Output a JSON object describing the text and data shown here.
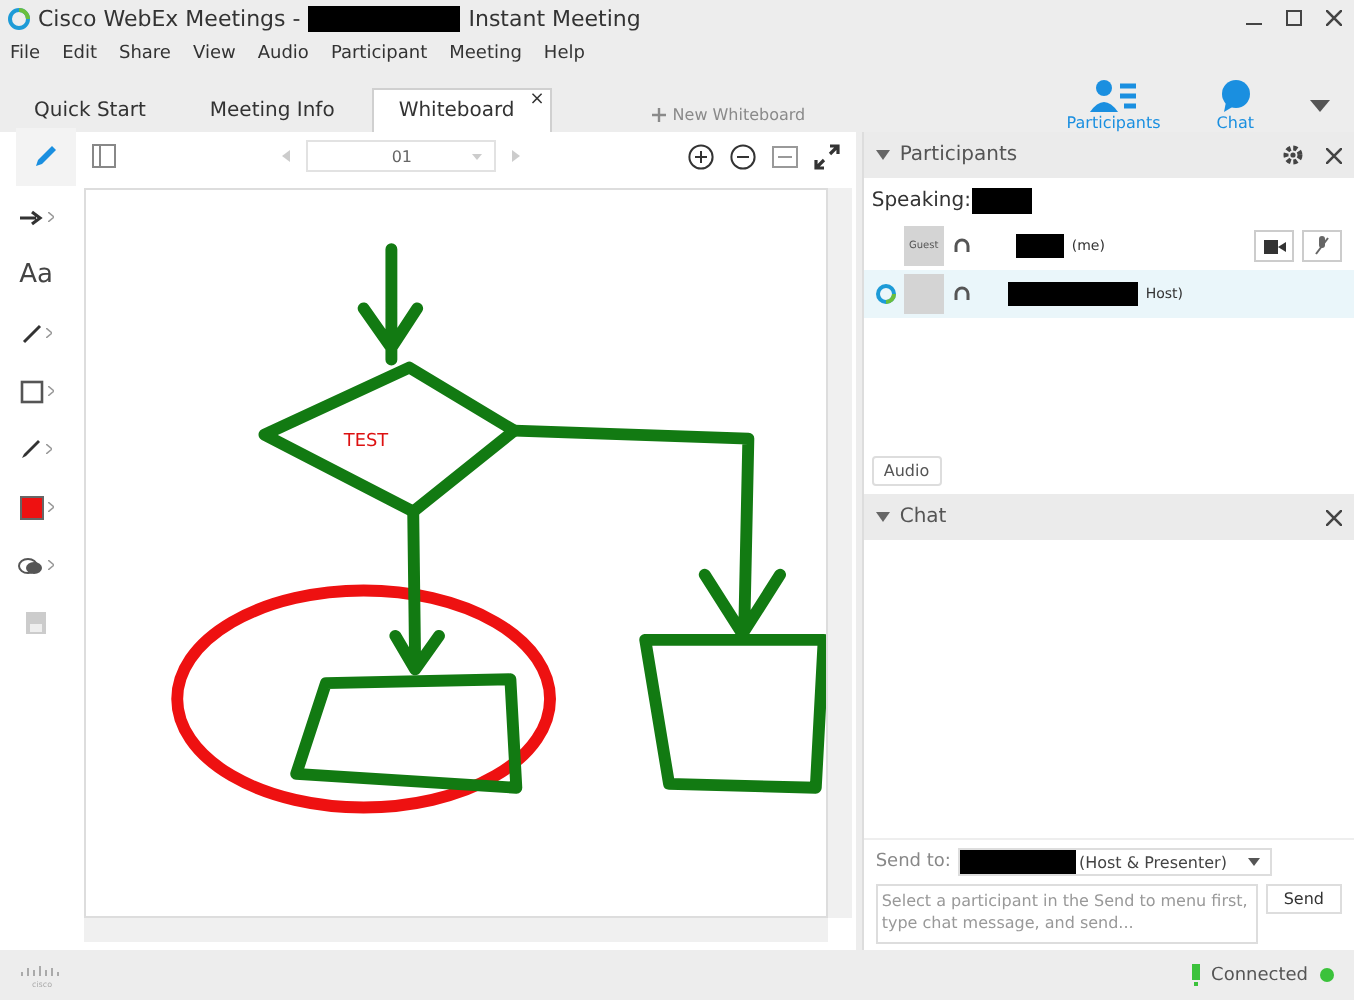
{
  "window": {
    "title_prefix": "Cisco WebEx Meetings - ",
    "title_suffix": "Instant Meeting"
  },
  "menu": [
    "File",
    "Edit",
    "Share",
    "View",
    "Audio",
    "Participant",
    "Meeting",
    "Help"
  ],
  "tabs": [
    {
      "label": "Quick Start",
      "selected": false
    },
    {
      "label": "Meeting Info",
      "selected": false
    },
    {
      "label": "Whiteboard",
      "selected": true,
      "close": "×"
    }
  ],
  "new_whiteboard": {
    "label": "New Whiteboard",
    "disabled": true
  },
  "panel_switches": [
    {
      "label": "Participants",
      "kind": "people"
    },
    {
      "label": "Chat",
      "kind": "chat"
    }
  ],
  "whiteboard": {
    "page": "01",
    "text": "TEST",
    "tools": [
      {
        "kind": "pen",
        "selected": true
      },
      {
        "kind": "arrow",
        "selected": false
      },
      {
        "kind": "text",
        "label": "Aa",
        "selected": false
      },
      {
        "kind": "line",
        "selected": false
      },
      {
        "kind": "rect",
        "selected": false
      },
      {
        "kind": "marker",
        "selected": false
      },
      {
        "kind": "color",
        "color": "#ee1111",
        "selected": false
      },
      {
        "kind": "eraser",
        "selected": false
      },
      {
        "kind": "save",
        "selected": false
      }
    ]
  },
  "participants": {
    "title": "Participants",
    "speaking": "Speaking:",
    "list": [
      {
        "avatar_label": "Guest",
        "suffix": "(me)",
        "selected": false,
        "host": false
      },
      {
        "suffix": "Host)",
        "selected": true,
        "host": true
      }
    ],
    "audio_button": "Audio"
  },
  "chat": {
    "title": "Chat",
    "send_to_label": "Send to:",
    "send_to_suffix": "(Host & Presenter)",
    "placeholder": "Select a participant in the Send to menu first, type chat message, and send...",
    "send_button": "Send"
  },
  "status": {
    "logo": "cisco",
    "connection": "Connected"
  }
}
